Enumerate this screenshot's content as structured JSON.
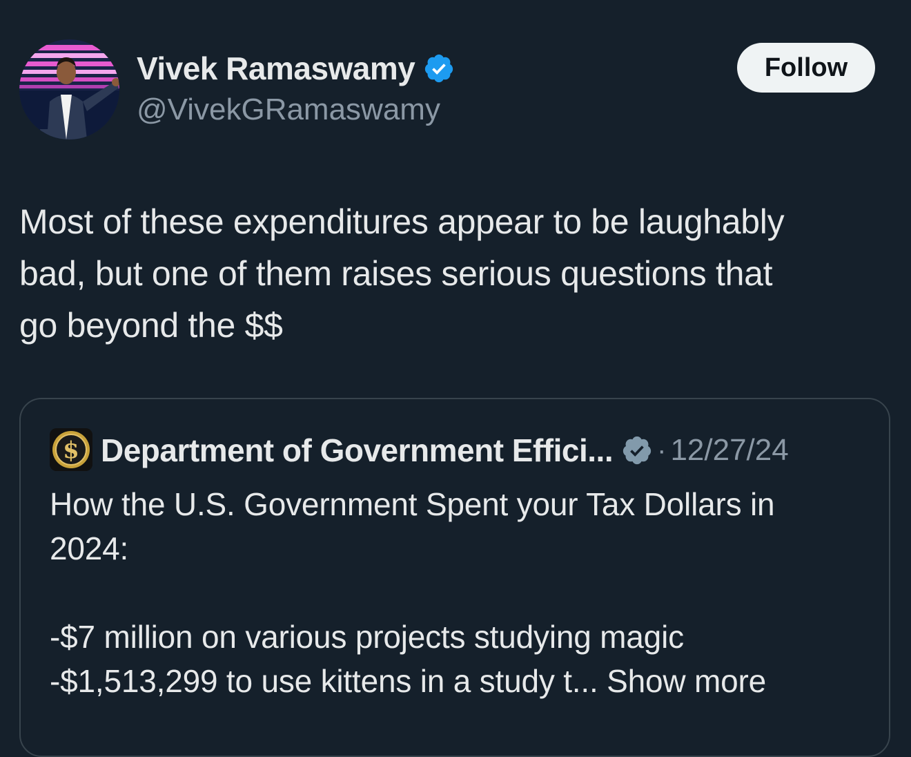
{
  "author": {
    "display_name": "Vivek Ramaswamy",
    "handle": "@VivekGRamaswamy",
    "verified_icon": "verified-badge-icon",
    "avatar": "profile-photo"
  },
  "follow_button": {
    "label": "Follow"
  },
  "tweet": {
    "text_line1": "Most of these expenditures appear to be laughably",
    "text_line2": "bad, but one of them raises serious questions that",
    "text_line3": "go beyond the $$"
  },
  "quote": {
    "avatar_icon": "dollar-coin-icon",
    "display_name": "Department of Government Effici...",
    "separator": "·",
    "date": "12/27/24",
    "line1": "How the U.S. Government Spent your Tax Dollars in",
    "line2": "2024:",
    "line3": "-$7 million on various projects studying magic",
    "line4_prefix": "-$1,513,299 to use kittens in a study t...",
    "show_more": "Show more"
  },
  "colors": {
    "background": "#15202b",
    "text": "#e7e9ea",
    "secondary_text": "#8b98a5",
    "verified_blue": "#1d9bf0",
    "border": "#38444d"
  }
}
